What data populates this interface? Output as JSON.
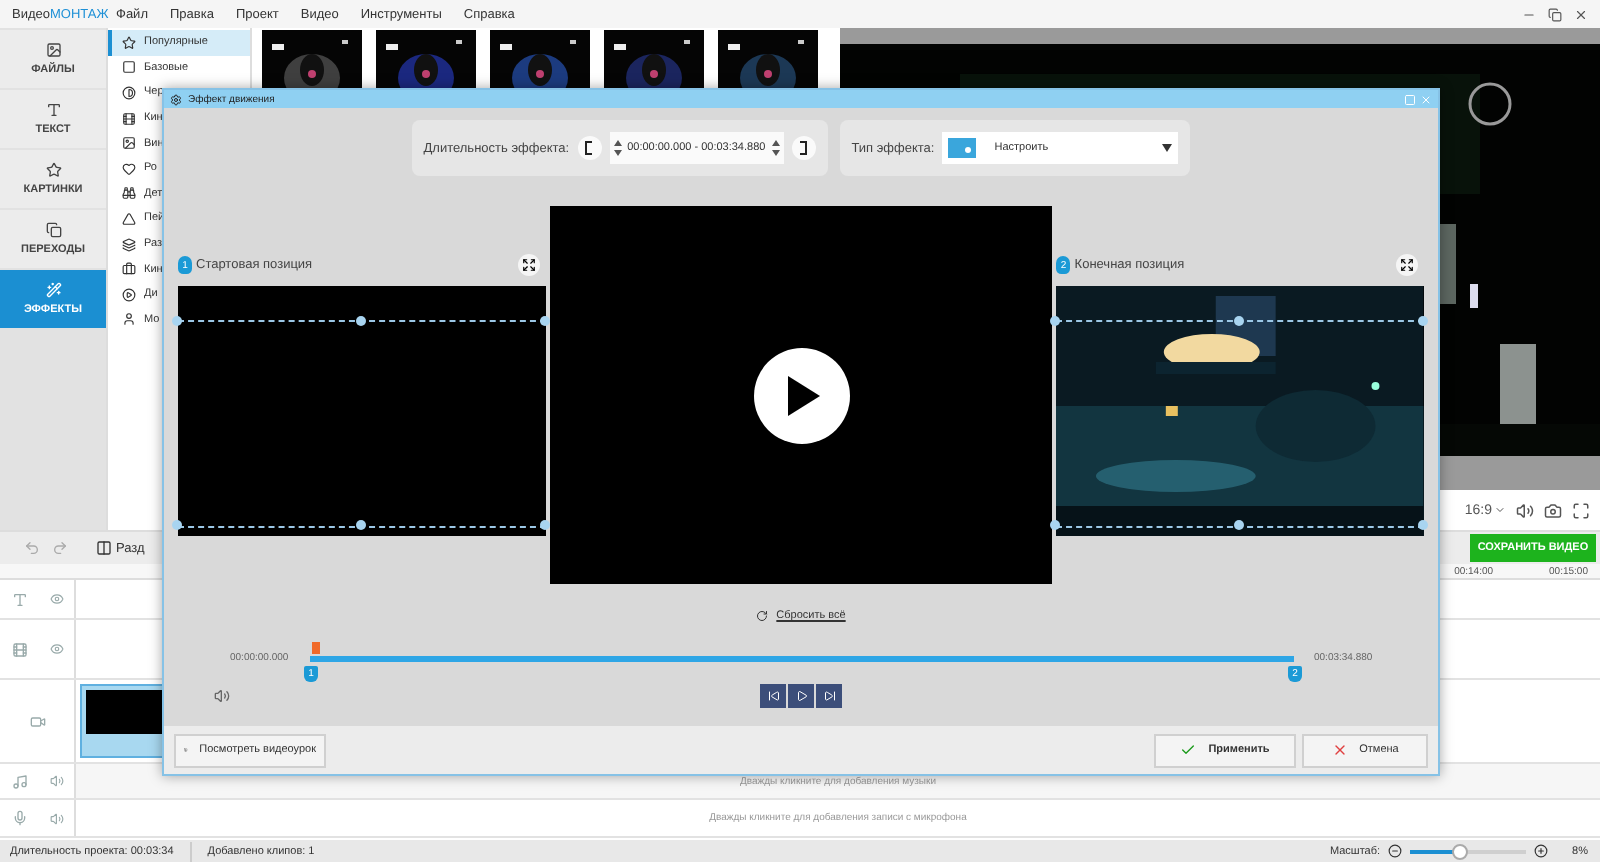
{
  "app": {
    "logo_prefix": "Видео",
    "logo_suffix": "МОНТАЖ"
  },
  "menu": [
    "Файл",
    "Правка",
    "Проект",
    "Видео",
    "Инструменты",
    "Справка"
  ],
  "sidebar": {
    "tabs": [
      {
        "label": "ФАЙЛЫ",
        "selected": false
      },
      {
        "label": "ТЕКСТ",
        "selected": false
      },
      {
        "label": "КАРТИНКИ",
        "selected": false
      },
      {
        "label": "ПЕРЕХОДЫ",
        "selected": false
      },
      {
        "label": "ЭФФЕКТЫ",
        "selected": true
      }
    ]
  },
  "categories": [
    {
      "label": "Популярные",
      "selected": true
    },
    {
      "label": "Базовые",
      "selected": false
    },
    {
      "label": "Чер",
      "selected": false
    },
    {
      "label": "Кин",
      "selected": false
    },
    {
      "label": "Вин",
      "selected": false
    },
    {
      "label": "Ро",
      "selected": false
    },
    {
      "label": "Дет",
      "selected": false
    },
    {
      "label": "Пей",
      "selected": false
    },
    {
      "label": "Раз",
      "selected": false
    },
    {
      "label": "Кин",
      "selected": false
    },
    {
      "label": "Ди",
      "selected": false
    },
    {
      "label": "Мо",
      "selected": false
    }
  ],
  "preview": {
    "aspect": "16:9"
  },
  "save_button": "СОХРАНИТЬ ВИДЕО",
  "toolbar": {
    "split": "Разд"
  },
  "ruler": [
    "00:14:00",
    "00:15:00"
  ],
  "tracks": [
    {
      "kind": "text"
    },
    {
      "kind": "overlay"
    },
    {
      "kind": "video"
    },
    {
      "kind": "music",
      "hint": "Дважды кликните для добавления музыки"
    },
    {
      "kind": "mic",
      "hint": "Дважды кликните для добавления записи с микрофона"
    }
  ],
  "status_bar": {
    "duration_label": "Длительность проекта:",
    "duration": "00:03:34",
    "clips": "Добавлено клипов: 1",
    "zoom_label": "Масштаб:",
    "zoom": {
      "level": 0.43
    },
    "zoom_value": "8%"
  },
  "dialog": {
    "title": "Эффект движения",
    "duration_label": "Длительность эффекта:",
    "duration_range": "00:00:00.000 - 00:03:34.880",
    "type_label": "Тип эффекта:",
    "type_value": "Настроить",
    "start_panel": {
      "badge": "1",
      "label": "Стартовая позиция"
    },
    "end_panel": {
      "badge": "2",
      "label": "Конечная позиция"
    },
    "reset": "Сбросить всё",
    "timeline": {
      "start": "00:00:00.000",
      "end": "00:03:34.880",
      "start_marker": "1",
      "end_marker": "2"
    },
    "tutorial_button": "Посмотреть видеоурок",
    "apply_button": "Применить",
    "cancel_button": "Отмена"
  }
}
